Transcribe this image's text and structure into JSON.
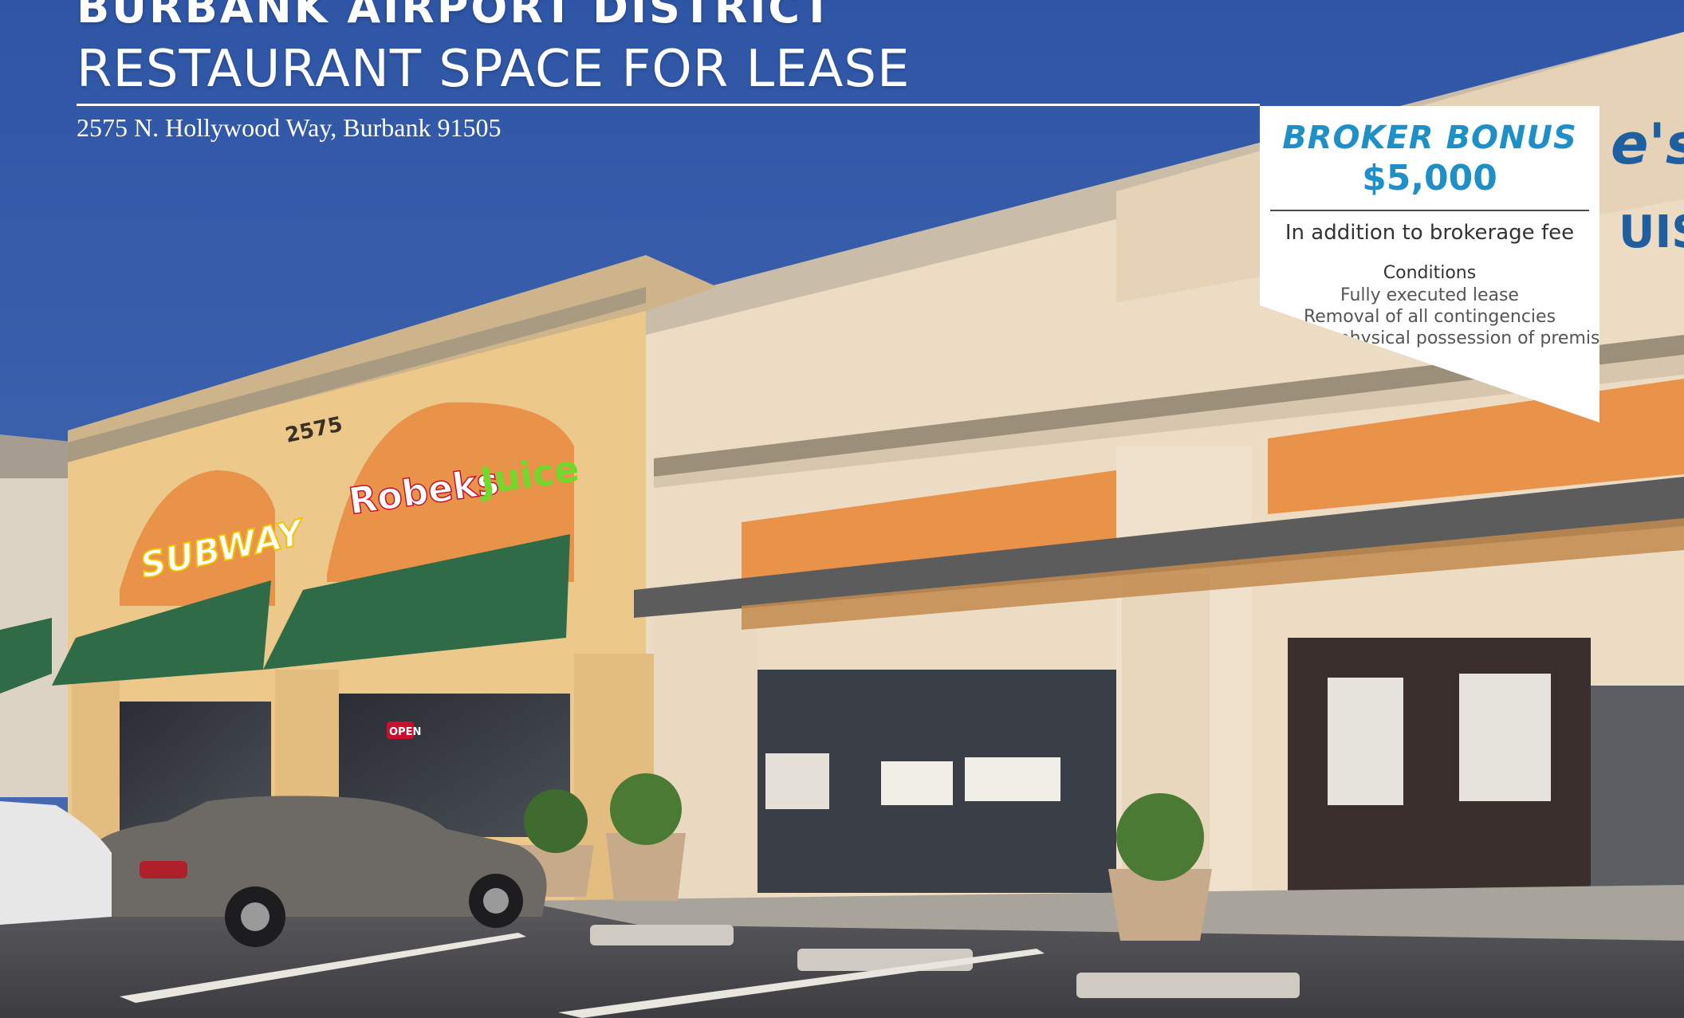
{
  "header": {
    "headline": "BURBANK AIRPORT DISTRICT",
    "subhead": "RESTAURANT SPACE FOR LEASE",
    "address": "2575 N. Hollywood Way, Burbank 91505"
  },
  "bonus": {
    "title": "BROKER BONUS",
    "amount": "$5,000",
    "note": "In addition to brokerage fee",
    "conditions_heading": "Conditions",
    "conditions": [
      "Fully executed lease",
      "Removal of all contingencies",
      "Tenant’s physical possession of premises"
    ]
  },
  "photo": {
    "building_number": "2575",
    "signs": {
      "subway": "SUBWAY",
      "robeks": "Robeks Juice",
      "right_partial": "e's",
      "right_partial_2": "UISI",
      "open": "OPEN"
    }
  },
  "colors": {
    "sky": "#3f63ad",
    "stucco_yellow": "#ecc98b",
    "stucco_cream": "#eddcc4",
    "orange_band": "#e8924a",
    "awning_green": "#2e6b46",
    "bonus_blue": "#1f8fc7",
    "pavement": "#4b4b4f"
  }
}
